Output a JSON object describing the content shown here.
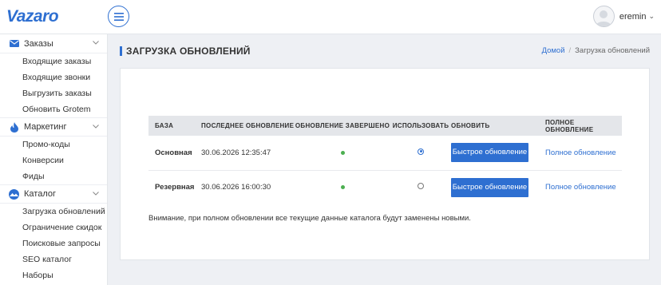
{
  "app": {
    "logo": "Vazaro"
  },
  "user": {
    "name": "eremin",
    "caret": "⌄"
  },
  "sidebar": {
    "groups": [
      {
        "label": "Заказы",
        "icon": "envelope-icon",
        "items": [
          "Входящие заказы",
          "Входящие звонки",
          "Выгрузить заказы",
          "Обновить Grotem"
        ]
      },
      {
        "label": "Маркетинг",
        "icon": "flame-icon",
        "items": [
          "Промо-коды",
          "Конверсии",
          "Фиды"
        ]
      },
      {
        "label": "Каталог",
        "icon": "catalog-icon",
        "items": [
          "Загрузка обновлений",
          "Ограничение скидок",
          "Поисковые запросы",
          "SEO каталог",
          "Наборы"
        ]
      }
    ]
  },
  "page": {
    "title": "ЗАГРУЗКА ОБНОВЛЕНИЙ",
    "breadcrumb": {
      "home": "Домой",
      "separator": "/",
      "current": "Загрузка обновлений"
    }
  },
  "table": {
    "headers": [
      "БАЗА",
      "ПОСЛЕДНЕЕ ОБНОВЛЕНИЕ",
      "ОБНОВЛЕНИЕ ЗАВЕРШЕНО",
      "ИСПОЛЬЗОВАТЬ",
      "ОБНОВИТЬ",
      "ПОЛНОЕ ОБНОВЛЕНИЕ"
    ],
    "rows": [
      {
        "base": "Основная",
        "last_update": "30.06.2026 12:35:47",
        "completed": true,
        "use_selected": true,
        "update_label": "Быстрое обновление",
        "full_update_label": "Полное обновление"
      },
      {
        "base": "Резервная",
        "last_update": "30.06.2026 16:00:30",
        "completed": true,
        "use_selected": false,
        "update_label": "Быстрое обновление",
        "full_update_label": "Полное обновление"
      }
    ]
  },
  "note": "Внимание, при полном обновлении все текущие данные каталога будут заменены новыми.",
  "colors": {
    "accent": "#2e6fd1",
    "status_ok": "#4caf50",
    "background": "#eef0f4"
  }
}
